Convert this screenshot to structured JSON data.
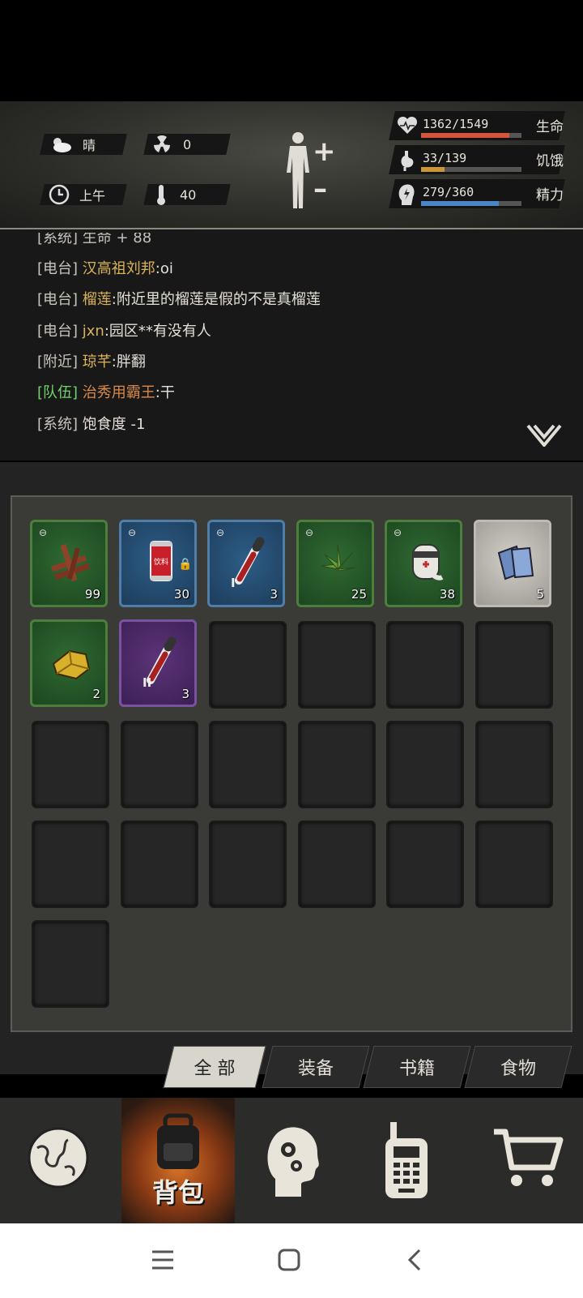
{
  "status": {
    "weather": "晴",
    "radiation": "0",
    "time_of_day": "上午",
    "temperature": "40",
    "health": {
      "value": "1362/1549",
      "label": "生命",
      "fraction": 0.879,
      "color": "#d4553c"
    },
    "hunger": {
      "value": "33/139",
      "label": "饥饿",
      "fraction": 0.237,
      "color": "#c9963a"
    },
    "energy": {
      "value": "279/360",
      "label": "精力",
      "fraction": 0.775,
      "color": "#4a86c8"
    }
  },
  "chat": {
    "partial_line": "[系统] 生命 + 88",
    "messages": [
      {
        "channel": "[电台]",
        "name": "汉高祖刘邦",
        "text": ":oi"
      },
      {
        "channel": "[电台]",
        "name": "榴莲",
        "text": ":附近里的榴莲是假的不是真榴莲"
      },
      {
        "channel": "[电台]",
        "name": "jxn",
        "text": ":园区**有没有人"
      },
      {
        "channel": "[附近]",
        "name": "琼芊",
        "text": ":胖翻"
      },
      {
        "channel": "[队伍]",
        "name": "治秀用霸王",
        "text": ":干"
      },
      {
        "channel": "[系统]",
        "name": "",
        "text": "饱食度 -1"
      }
    ]
  },
  "inventory": {
    "items": [
      {
        "name": "wood-sticks",
        "qty": "99",
        "rarity": "green",
        "linked": true
      },
      {
        "name": "drink-can",
        "qty": "30",
        "rarity": "blue",
        "linked": true,
        "locked": true,
        "can_label": "饮料"
      },
      {
        "name": "blood-vial-1",
        "qty": "3",
        "rarity": "blue",
        "linked": true,
        "tier": "I"
      },
      {
        "name": "herb-leaf",
        "qty": "25",
        "rarity": "green",
        "linked": true
      },
      {
        "name": "bandage",
        "qty": "38",
        "rarity": "green",
        "linked": true
      },
      {
        "name": "cloth-scraps",
        "qty": "5",
        "rarity": "grey",
        "linked": false
      },
      {
        "name": "gold-ore",
        "qty": "2",
        "rarity": "green",
        "linked": false
      },
      {
        "name": "blood-vial-2",
        "qty": "3",
        "rarity": "purple",
        "linked": false,
        "tier": "II"
      }
    ]
  },
  "tabs": [
    {
      "label": "全 部",
      "active": true
    },
    {
      "label": "装备",
      "active": false
    },
    {
      "label": "书籍",
      "active": false
    },
    {
      "label": "食物",
      "active": false
    }
  ],
  "nav": {
    "backpack_label": "背包"
  }
}
